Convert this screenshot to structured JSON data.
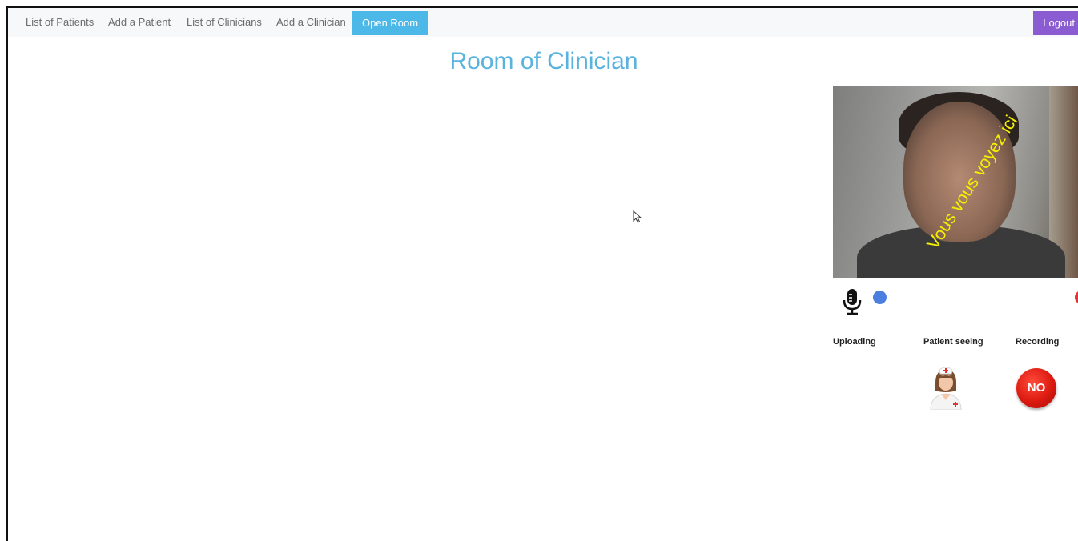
{
  "nav": {
    "items": [
      "List of Patients",
      "Add a Patient",
      "List of Clinicians",
      "Add a Clinician"
    ],
    "active": "Open Room",
    "logout": "Logout"
  },
  "page": {
    "title": "Room of Clinician"
  },
  "video": {
    "overlay_text": "Vous vous voyez ici"
  },
  "status": {
    "uploading_label": "Uploading",
    "patient_seeing_label": "Patient seeing",
    "recording_label": "Recording",
    "recording_value": "NO"
  },
  "colors": {
    "nav_active": "#4cb8e8",
    "logout": "#8a5bd1",
    "title": "#5ab3de",
    "indicator_blue": "#4a7fdf",
    "indicator_red": "#e23232"
  }
}
